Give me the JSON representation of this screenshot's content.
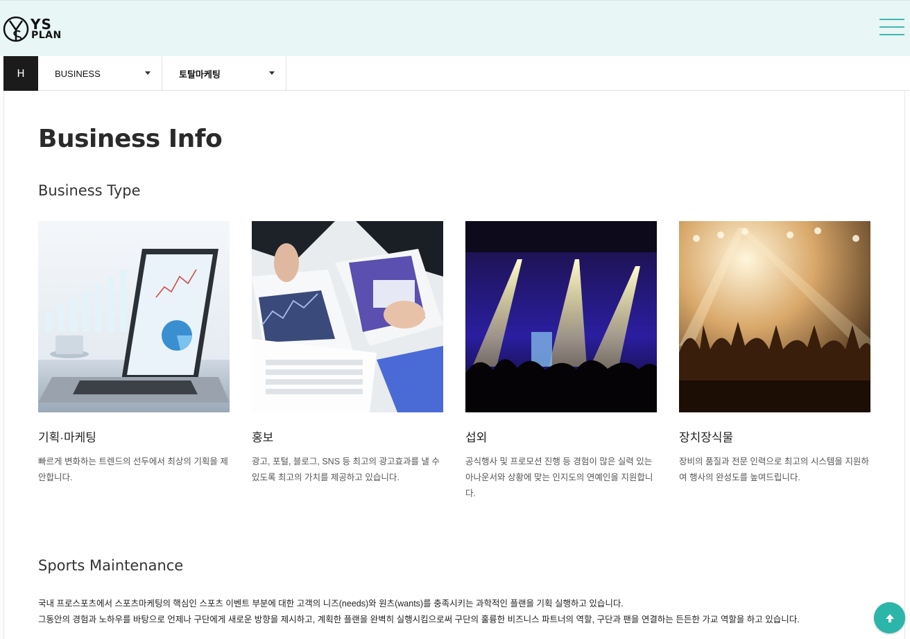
{
  "brand": {
    "logo_ys": "YS",
    "logo_plan": "PLAN"
  },
  "subnav": {
    "home_label": "H",
    "dropdown1": "BUSINESS",
    "dropdown2": "토탈마케팅"
  },
  "page": {
    "title": "Business Info",
    "section1": "Business Type",
    "section2": "Sports Maintenance"
  },
  "cards": [
    {
      "title": "기획·마케팅",
      "desc": "빠르게 변화하는 트렌드의 선두에서 최상의 기획을 제안합니다."
    },
    {
      "title": "홍보",
      "desc": "광고, 포털, 블로그, SNS 등 최고의 광고효과를 낼 수 있도록 최고의 가치를 제공하고 있습니다."
    },
    {
      "title": "섭외",
      "desc": "공식행사 및 프로모션 진행 등 경험이 많은 실력 있는 아나운서와 상황에 맞는 인지도의 연예인을 지원합니다."
    },
    {
      "title": "장치장식물",
      "desc": "장비의 품질과 전문 인력으로 최고의 시스템을 지원하여 행사의 완성도를 높여드립니다."
    }
  ],
  "maintenance": {
    "line1": "국내 프로스포츠에서 스포츠마케팅의 핵심인 스포츠 이벤트 부분에 대한 고객의 니즈(needs)와 원츠(wants)를 충족시키는 과학적인 플랜을 기획 실행하고 있습니다.",
    "line2": "그동안의 경험과 노하우를 바탕으로 언제나 구단에게 새로운 방향을 제시하고, 계획한 플랜을 완벽히 실행시킴으로써 구단의 훌륭한 비즈니스 파트너의 역할, 구단과 팬을 연결하는 든든한 가교 역할을 하고 있습니다."
  },
  "colors": {
    "accent": "#2cb5a9",
    "header_bg": "#e8f6f5",
    "home_bg": "#1b1b1b"
  },
  "icons": {
    "menu": "hamburger-icon",
    "top": "arrow-up-icon",
    "dropdown": "caret-down-icon"
  }
}
